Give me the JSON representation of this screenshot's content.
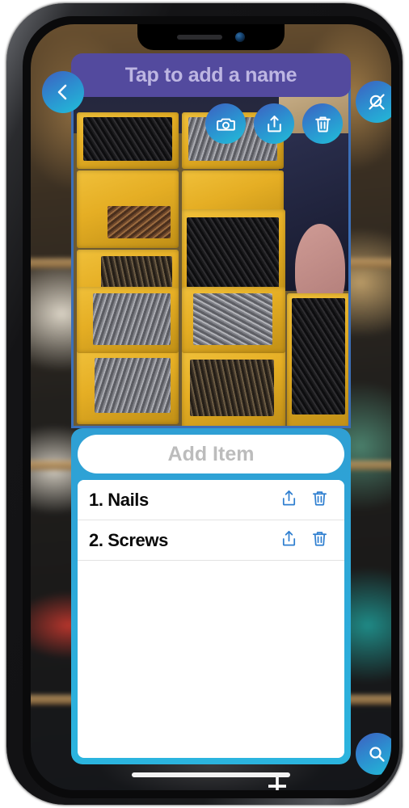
{
  "app": {
    "header": {
      "title": "Tap to add a name",
      "title_color": "#bdb6e2",
      "bar_color": "#534a9e"
    },
    "nav": {
      "back_label": "Back",
      "back_icon": "chevron-left-icon",
      "hide_search_label": "Hide search",
      "hide_search_icon": "search-off-icon"
    },
    "photo": {
      "alt": "Yellow storage bins filled with nails and screws",
      "toolbar": [
        {
          "id": "camera",
          "label": "Take photo",
          "icon": "camera-icon"
        },
        {
          "id": "share",
          "label": "Share photo",
          "icon": "share-upload-icon"
        },
        {
          "id": "delete",
          "label": "Delete photo",
          "icon": "trash-icon"
        }
      ]
    },
    "add_item": {
      "placeholder": "Add Item",
      "value": ""
    },
    "items": [
      {
        "number": "1.",
        "name": "Nails",
        "display": "1. Nails",
        "share_icon": "share-upload-icon",
        "share_label": "Share item",
        "delete_icon": "trash-icon",
        "delete_label": "Delete item"
      },
      {
        "number": "2.",
        "name": "Screws",
        "display": "2. Screws",
        "share_icon": "share-upload-icon",
        "share_label": "Share item",
        "delete_icon": "trash-icon",
        "delete_label": "Delete item"
      }
    ],
    "fab": {
      "label": "Search",
      "icon": "search-icon"
    },
    "colors": {
      "accent_cyan": "#2bb4de",
      "accent_blue": "#2f7fd0",
      "header_purple": "#534a9e",
      "button_gradient_start": "#3e5fc0",
      "button_gradient_end": "#21bfd8",
      "item_icon_blue": "#2f7fd0",
      "placeholder_grey": "#bcbcbc"
    }
  },
  "device": {
    "status": {
      "speaker": "speaker-grille",
      "camera": "front-camera",
      "home_indicator": "home-indicator"
    }
  }
}
